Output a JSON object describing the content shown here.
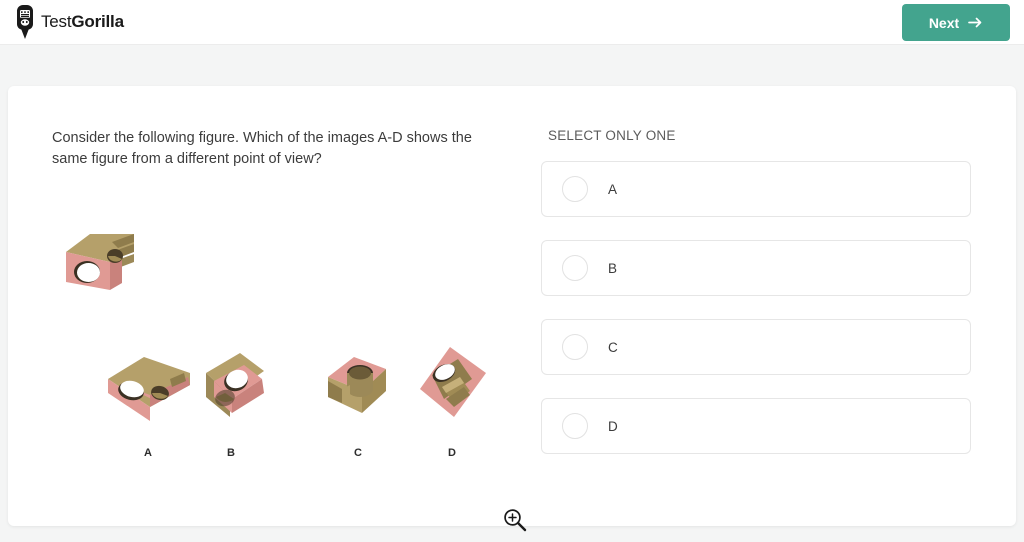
{
  "header": {
    "logo_text_light": "Test",
    "logo_text_bold": "Gorilla",
    "logo_icon": "gorilla-head-icon",
    "next_label": "Next",
    "next_icon": "arrow-right-icon",
    "accent_color": "#43a48e"
  },
  "question": {
    "text": "Consider the following figure. Which of the images A-D shows the same figure from a different point of view?"
  },
  "figures": {
    "reference_name": "reference-3d-figure",
    "zoom_icon": "magnifier-plus-icon",
    "options": [
      {
        "label": "A",
        "name": "option-figure-a"
      },
      {
        "label": "B",
        "name": "option-figure-b"
      },
      {
        "label": "C",
        "name": "option-figure-c"
      },
      {
        "label": "D",
        "name": "option-figure-d"
      }
    ],
    "colors": {
      "pink": "#e09a94",
      "pink_dark": "#c9827c",
      "tan": "#b5a06a",
      "tan_dark": "#8f7c4c",
      "hole_dark": "#3a3022"
    }
  },
  "answers": {
    "hint": "SELECT ONLY ONE",
    "options": [
      {
        "label": "A"
      },
      {
        "label": "B"
      },
      {
        "label": "C"
      },
      {
        "label": "D"
      }
    ]
  }
}
